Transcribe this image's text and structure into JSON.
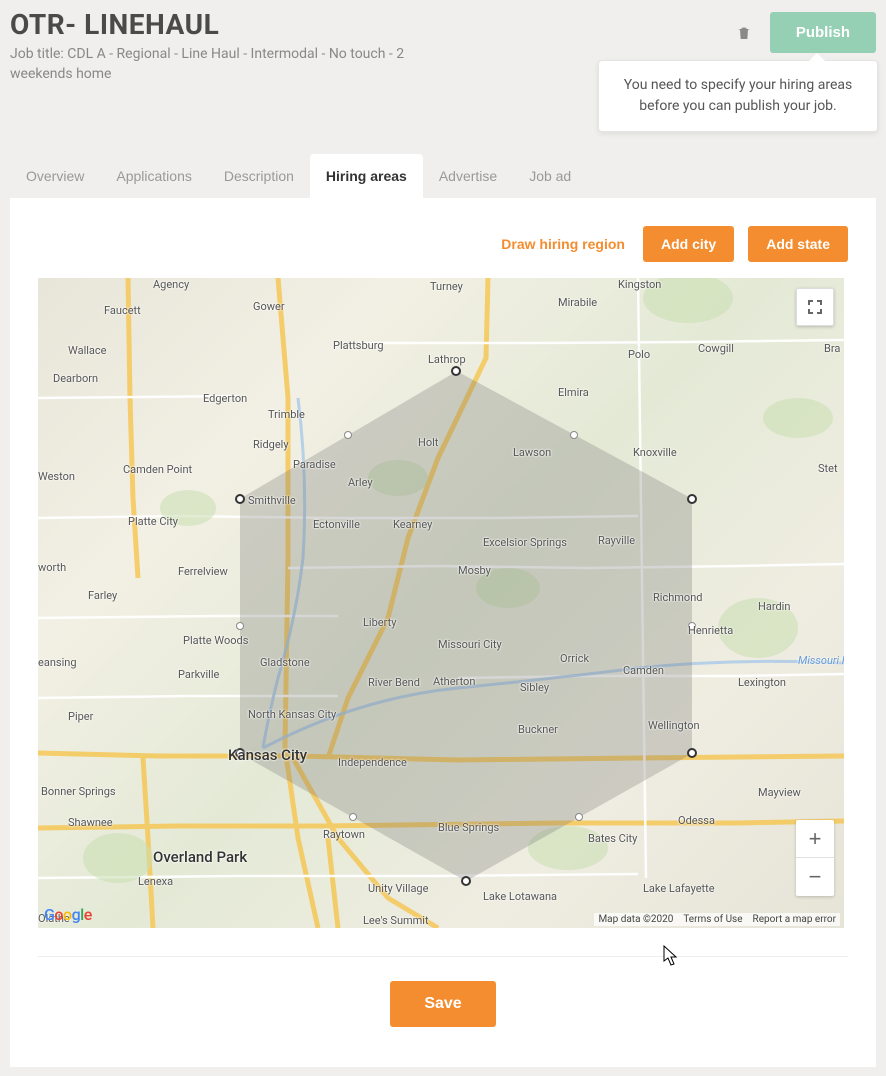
{
  "header": {
    "title": "OTR- LINEHAUL",
    "subtitle": "Job title: CDL A - Regional - Line Haul - Intermodal - No touch - 2 weekends home",
    "publish_label": "Publish",
    "tooltip": "You need to specify your hiring areas before you can publish your job."
  },
  "tabs": [
    {
      "label": "Overview",
      "active": false
    },
    {
      "label": "Applications",
      "active": false
    },
    {
      "label": "Description",
      "active": false
    },
    {
      "label": "Hiring areas",
      "active": true
    },
    {
      "label": "Advertise",
      "active": false
    },
    {
      "label": "Job ad",
      "active": false
    }
  ],
  "toolbar": {
    "draw_label": "Draw hiring region",
    "add_city_label": "Add city",
    "add_state_label": "Add state"
  },
  "map": {
    "attrib_data": "Map data ©2020",
    "attrib_terms": "Terms of Use",
    "attrib_report": "Report a map error",
    "zoom_in": "+",
    "zoom_out": "−",
    "labels": {
      "kansas_city": "Kansas City",
      "overland_park": "Overland Park",
      "independence": "Independence",
      "liberty": "Liberty",
      "gladstone": "Gladstone",
      "blue_springs": "Blue Springs",
      "lees_summit": "Lee's Summit",
      "shawnee": "Shawnee",
      "lenexa": "Lenexa",
      "olathe": "Olathe",
      "platte_city": "Platte City",
      "smithville": "Smithville",
      "kearney": "Kearney",
      "excelsior": "Excelsior Springs",
      "lawson": "Lawson",
      "richmond": "Richmond",
      "henrietta": "Henrietta",
      "orrick": "Orrick",
      "camden": "Camden",
      "rayville": "Rayville",
      "wellington": "Wellington",
      "lexington": "Lexington",
      "odessa": "Odessa",
      "mayview": "Mayview",
      "bates_city": "Bates City",
      "lake_lafayette": "Lake Lafayette",
      "buckner": "Buckner",
      "sibley": "Sibley",
      "atherton": "Atherton",
      "missouri_city": "Missouri City",
      "mosby": "Mosby",
      "holt": "Holt",
      "lathrop": "Lathrop",
      "plattsburg": "Plattsburg",
      "gower": "Gower",
      "faucett": "Faucett",
      "dearborn": "Dearborn",
      "edgerton": "Edgerton",
      "trimble": "Trimble",
      "ridgely": "Ridgely",
      "camden_point": "Camden Point",
      "wallace": "Wallace",
      "turney": "Turney",
      "mirabile": "Mirabile",
      "kingston": "Kingston",
      "polo": "Polo",
      "cowgill": "Cowgill",
      "elmira": "Elmira",
      "knoxville": "Knoxville",
      "hardin": "Hardin",
      "stet": "Stet",
      "bra": "Bra",
      "piper": "Piper",
      "parkville": "Parkville",
      "north_kc": "North Kansas City",
      "bonner": "Bonner Springs",
      "farley": "Farley",
      "ferrelview": "Ferrelview",
      "platte_woods": "Platte Woods",
      "raytown": "Raytown",
      "unity": "Unity Village",
      "river_bend": "River Bend",
      "arley": "Arley",
      "ectonville": "Ectonville",
      "paradise": "Paradise",
      "lake_lotawana": "Lake Lotawana",
      "eansing": "eansing",
      "worth": "worth",
      "agency": "Agency",
      "weston": "Weston",
      "missouri_r": "Missouri R"
    }
  },
  "save_label": "Save"
}
